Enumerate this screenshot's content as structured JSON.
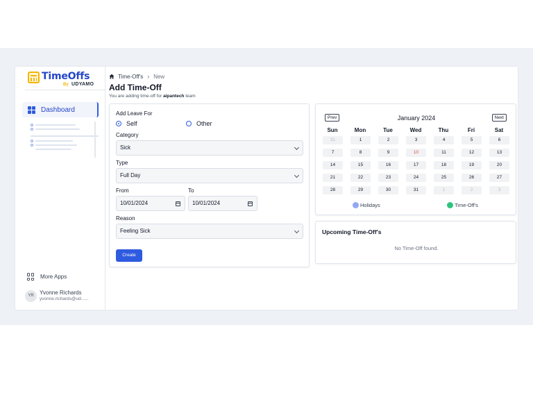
{
  "app": {
    "logo_title": "TimeOffs",
    "logo_by": "By",
    "logo_brand": "UDYAMO",
    "colors": {
      "accent": "#2f5be0",
      "brand_title": "#2446c9",
      "logo_yellow": "#f5b301",
      "holidays": "#93a8f0",
      "timeoffs": "#2ec47e",
      "today": "#e0483e"
    }
  },
  "sidebar": {
    "dashboard_label": "Dashboard",
    "dashboard_icon": "grid-icon",
    "more_apps_label": "More Apps",
    "more_apps_icon": "apps-icon",
    "user": {
      "initials": "YR",
      "name": "Yvonne Richards",
      "email": "yvonne.richards@ud......"
    }
  },
  "header": {
    "breadcrumb": {
      "home": "Time-Off's",
      "current": "New"
    },
    "title": "Add Time-Off",
    "subtitle_prefix": "You are adding time-off for ",
    "team": "aipantech",
    "subtitle_suffix": " team"
  },
  "form": {
    "leave_for_label": "Add Leave For",
    "options": {
      "self": "Self",
      "other": "Other"
    },
    "selected": "self",
    "category_label": "Category",
    "category_value": "Sick",
    "type_label": "Type",
    "type_value": "Full Day",
    "from_label": "From",
    "from_value": "10/01/2024",
    "to_label": "To",
    "to_value": "10/01/2024",
    "reason_label": "Reason",
    "reason_value": "Feeling Sick",
    "create_label": "Create"
  },
  "calendar": {
    "prev": "Prev",
    "next": "Next",
    "month": "January 2024",
    "weekdays": [
      "Sun",
      "Mon",
      "Tue",
      "Wed",
      "Thu",
      "Fri",
      "Sat"
    ],
    "weeks": [
      [
        "31",
        "1",
        "2",
        "3",
        "4",
        "5",
        "6"
      ],
      [
        "7",
        "8",
        "9",
        "10",
        "11",
        "12",
        "13"
      ],
      [
        "14",
        "15",
        "16",
        "17",
        "18",
        "19",
        "20"
      ],
      [
        "21",
        "22",
        "23",
        "24",
        "25",
        "26",
        "27"
      ],
      [
        "28",
        "29",
        "30",
        "31",
        "1",
        "2",
        "3"
      ]
    ],
    "muted": [
      [
        0,
        0
      ],
      [
        4,
        4
      ],
      [
        4,
        5
      ],
      [
        4,
        6
      ]
    ],
    "highlighted": [
      [
        1,
        3
      ]
    ],
    "legend": {
      "holidays": "Holidays",
      "timeoffs": "Time-Off's"
    }
  },
  "upcoming": {
    "title": "Upcoming Time-Off's",
    "empty": "No Time-Off found."
  }
}
